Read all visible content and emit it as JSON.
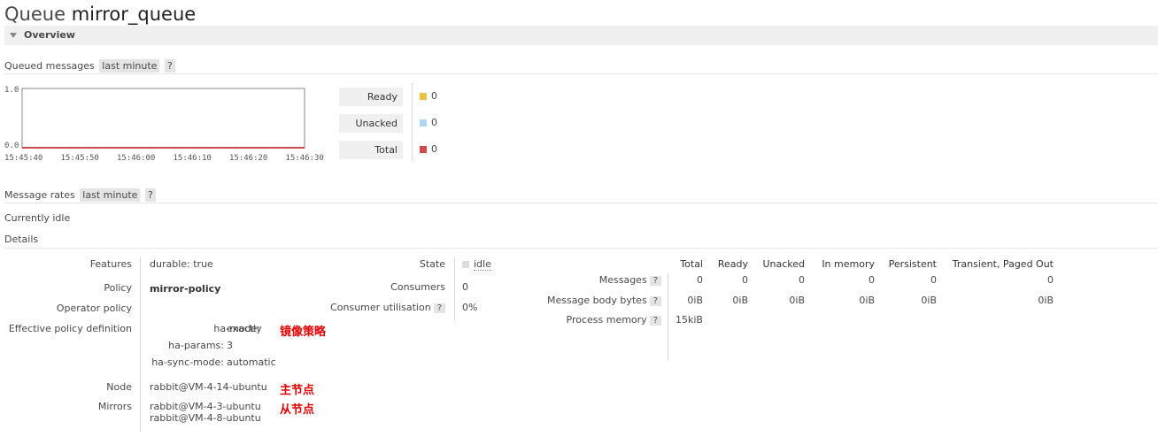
{
  "header": {
    "title_prefix": "Queue",
    "queue_name": "mirror_queue"
  },
  "overview": {
    "section_label": "Overview"
  },
  "queued_messages": {
    "label": "Queued messages",
    "range_label": "last minute",
    "help": "?",
    "chart_data": {
      "type": "line",
      "x": [
        "15:45:40",
        "15:45:50",
        "15:46:00",
        "15:46:10",
        "15:46:20",
        "15:46:30"
      ],
      "ylim": [
        0.0,
        1.0
      ],
      "y_ticks": [
        "1.0",
        "0.0"
      ],
      "series": [
        {
          "name": "Ready",
          "values": [
            0,
            0,
            0,
            0,
            0,
            0
          ],
          "color": "#edc240"
        },
        {
          "name": "Unacked",
          "values": [
            0,
            0,
            0,
            0,
            0,
            0
          ],
          "color": "#afd8f8"
        },
        {
          "name": "Total",
          "values": [
            0,
            0,
            0,
            0,
            0,
            0
          ],
          "color": "#cb4b4b"
        }
      ]
    },
    "legend": [
      {
        "label": "Ready",
        "value": "0",
        "color": "#edc240"
      },
      {
        "label": "Unacked",
        "value": "0",
        "color": "#afd8f8"
      },
      {
        "label": "Total",
        "value": "0",
        "color": "#cb4b4b"
      }
    ]
  },
  "message_rates": {
    "label": "Message rates",
    "range_label": "last minute",
    "help": "?",
    "status": "Currently idle"
  },
  "details": {
    "label": "Details",
    "features_label": "Features",
    "features_key": "durable:",
    "features_value": "true",
    "policy_label": "Policy",
    "policy_value": "mirror-policy",
    "operator_policy_label": "Operator policy",
    "effective_label": "Effective policy definition",
    "ha_mode_key": "ha-mode:",
    "ha_mode_value": "exactly",
    "ha_params_key": "ha-params:",
    "ha_params_value": "3",
    "ha_sync_key": "ha-sync-mode:",
    "ha_sync_value": "automatic",
    "node_label": "Node",
    "node_value": "rabbit@VM-4-14-ubuntu",
    "mirrors_label": "Mirrors",
    "mirror_1": "rabbit@VM-4-3-ubuntu",
    "mirror_2": "rabbit@VM-4-8-ubuntu",
    "annotation_policy": "镜像策略",
    "annotation_master": "主节点",
    "annotation_slave": "从节点",
    "state_label": "State",
    "state_value": "idle",
    "consumers_label": "Consumers",
    "consumers_value": "0",
    "consumer_util_label": "Consumer utilisation",
    "consumer_util_help": "?",
    "consumer_util_value": "0%",
    "stats": {
      "columns": [
        "Total",
        "Ready",
        "Unacked",
        "In memory",
        "Persistent",
        "Transient, Paged Out"
      ],
      "messages_label": "Messages",
      "messages_help": "?",
      "messages": [
        "0",
        "0",
        "0",
        "0",
        "0",
        "0"
      ],
      "body_label": "Message body bytes",
      "body_help": "?",
      "body": [
        "0iB",
        "0iB",
        "0iB",
        "0iB",
        "0iB",
        "0iB"
      ],
      "process_label": "Process memory",
      "process_help": "?",
      "process_value": "15kiB"
    }
  }
}
